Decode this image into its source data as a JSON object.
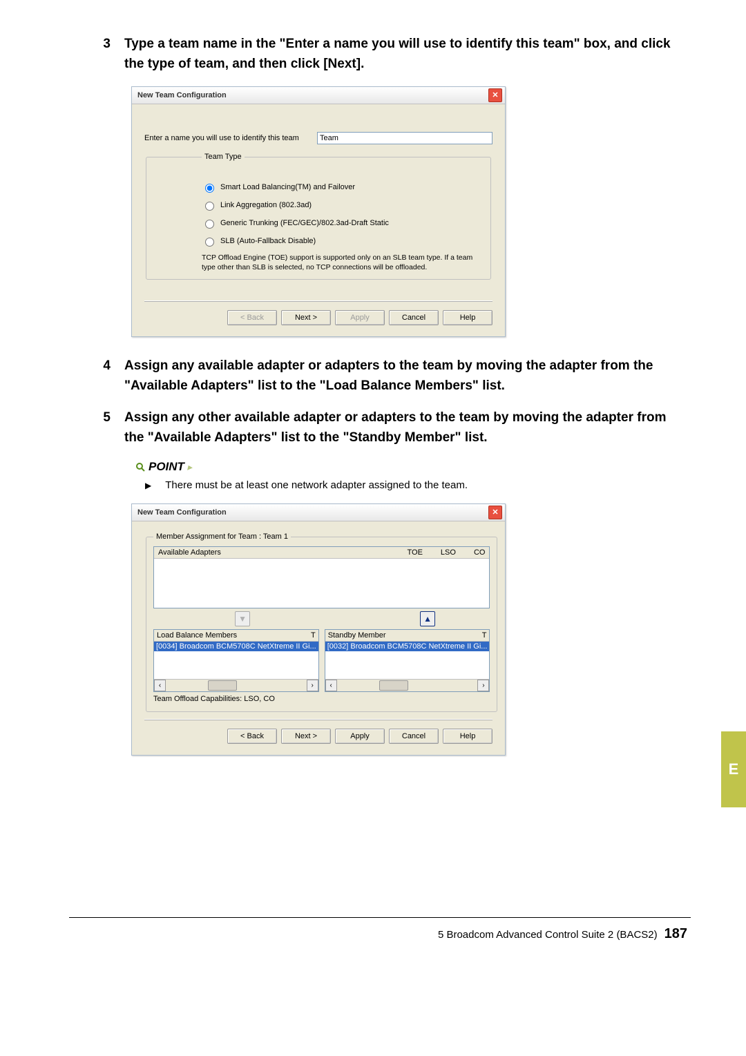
{
  "steps": {
    "s3": {
      "num": "3",
      "text": "Type a team name in the \"Enter a name you will use to identify this team\" box, and click the type of team, and then click [Next]."
    },
    "s4": {
      "num": "4",
      "text": "Assign any available adapter or adapters to the team by moving the adapter from the \"Available Adapters\" list to the \"Load Balance Members\" list."
    },
    "s5": {
      "num": "5",
      "text": "Assign any other available adapter or adapters to the team by moving the adapter from the \"Available Adapters\" list to the \"Standby Member\" list."
    }
  },
  "point": {
    "heading": "POINT",
    "bullet": "There must be at least one network adapter assigned to the team."
  },
  "dialog1": {
    "title": "New Team Configuration",
    "name_label": "Enter a name you will use to identify this team",
    "name_value": "Team",
    "teamtype_legend": "Team Type",
    "radios": [
      "Smart Load Balancing(TM) and Failover",
      "Link Aggregation (802.3ad)",
      "Generic Trunking (FEC/GEC)/802.3ad-Draft Static",
      "SLB (Auto-Fallback Disable)"
    ],
    "note": "TCP Offload Engine (TOE) support is supported only on an SLB team type.  If a team type other than SLB is selected, no TCP connections will be offloaded.",
    "buttons": {
      "back": "< Back",
      "next": "Next >",
      "apply": "Apply",
      "cancel": "Cancel",
      "help": "Help"
    }
  },
  "dialog2": {
    "title": "New Team Configuration",
    "member_legend": "Member Assignment for Team : Team 1",
    "available_label": "Available Adapters",
    "cols": {
      "toe": "TOE",
      "lso": "LSO",
      "co": "CO",
      "t": "T"
    },
    "load_label": "Load Balance Members",
    "load_selected": "[0034] Broadcom BCM5708C NetXtreme II Gi...",
    "standby_label": "Standby Member",
    "standby_selected": "[0032] Broadcom BCM5708C NetXtreme II Gi...",
    "caps": "Team Offload Capabilities:  LSO, CO",
    "buttons": {
      "back": "< Back",
      "next": "Next >",
      "apply": "Apply",
      "cancel": "Cancel",
      "help": "Help"
    }
  },
  "footer": {
    "section": "5  Broadcom Advanced Control Suite 2 (BACS2)",
    "page": "187",
    "tab": "E"
  }
}
